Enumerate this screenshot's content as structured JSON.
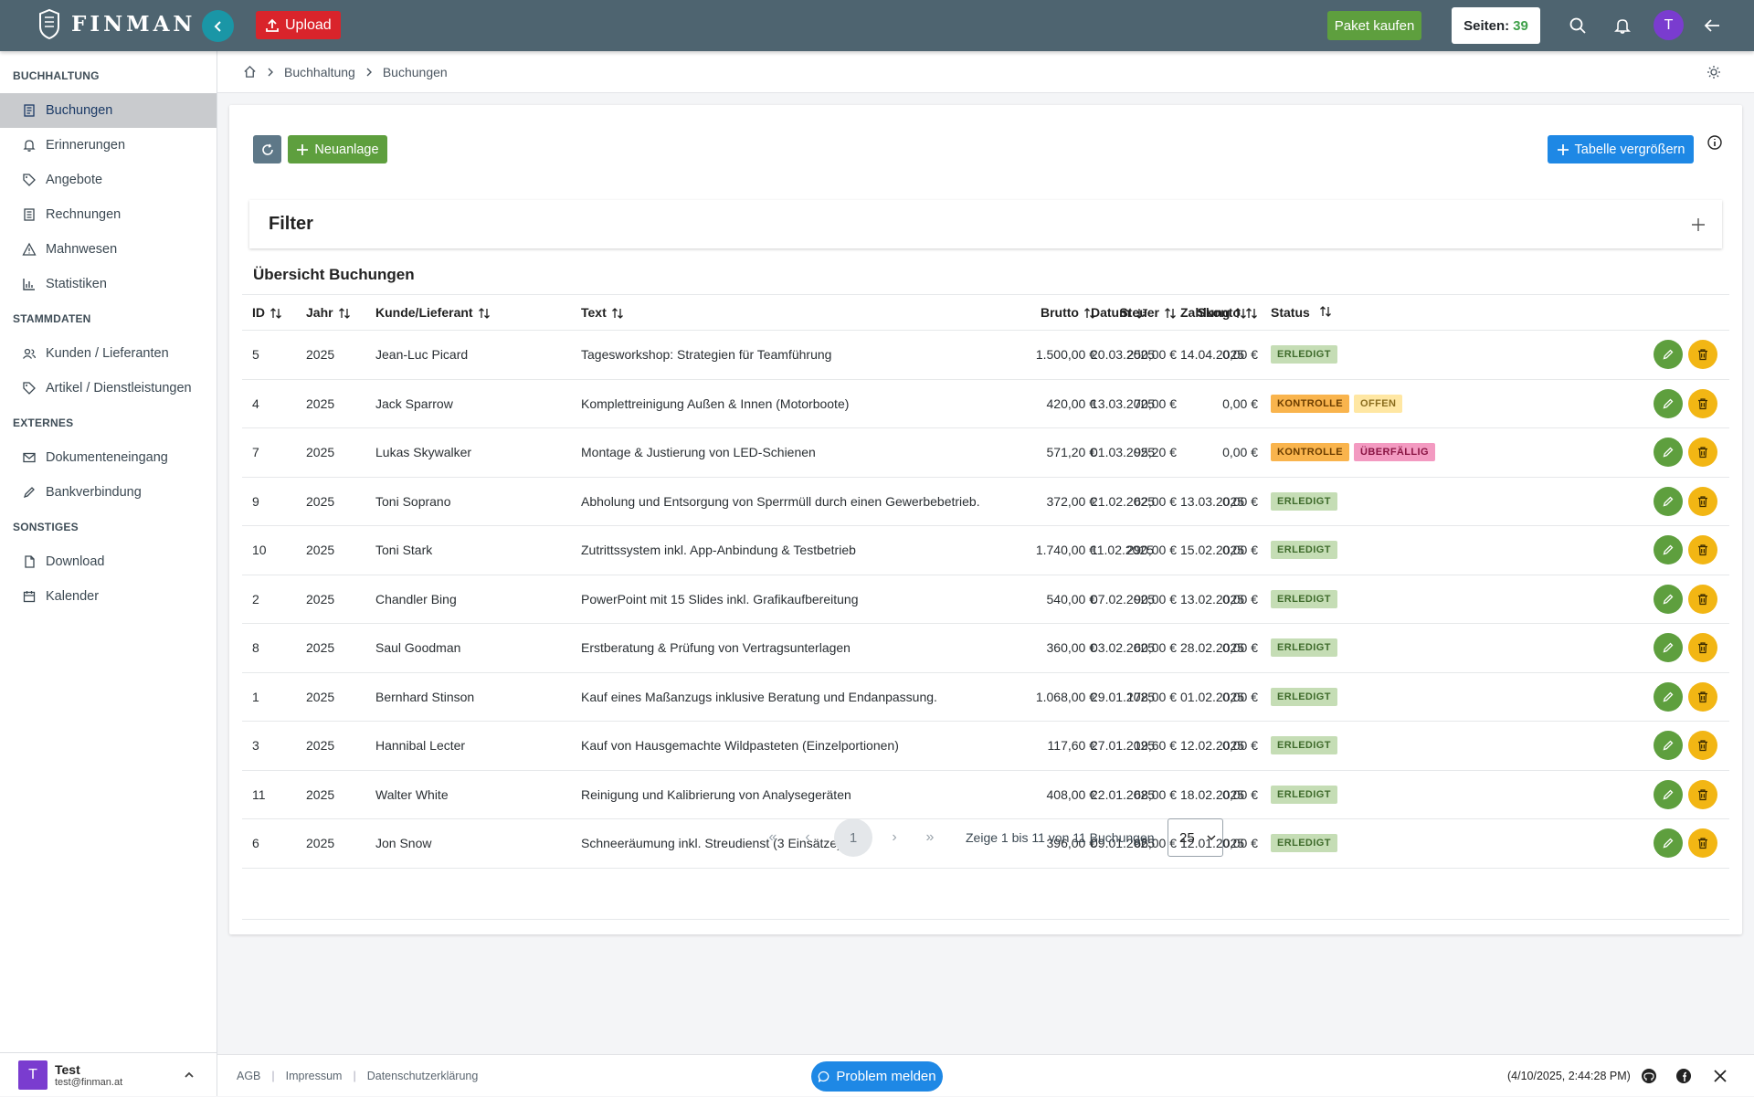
{
  "app": {
    "name": "FINMAN"
  },
  "topbar": {
    "upload_label": "Upload",
    "buy_label": "Paket kaufen",
    "pages_label": "Seiten:",
    "pages_value": "39",
    "avatar_letter": "T"
  },
  "sidebar": {
    "sections": [
      {
        "title": "BUCHHALTUNG",
        "items": [
          {
            "label": "Buchungen",
            "icon": "ledger-icon",
            "active": true
          },
          {
            "label": "Erinnerungen",
            "icon": "bell-icon"
          },
          {
            "label": "Angebote",
            "icon": "tag-icon"
          },
          {
            "label": "Rechnungen",
            "icon": "invoice-icon"
          },
          {
            "label": "Mahnwesen",
            "icon": "warning-icon"
          },
          {
            "label": "Statistiken",
            "icon": "chart-icon"
          }
        ]
      },
      {
        "title": "STAMMDATEN",
        "items": [
          {
            "label": "Kunden / Lieferanten",
            "icon": "users-icon"
          },
          {
            "label": "Artikel / Dienstleistungen",
            "icon": "tag-icon"
          }
        ]
      },
      {
        "title": "EXTERNES",
        "items": [
          {
            "label": "Dokumenteneingang",
            "icon": "mail-icon"
          },
          {
            "label": "Bankverbindung",
            "icon": "pen-icon"
          }
        ]
      },
      {
        "title": "SONSTIGES",
        "items": [
          {
            "label": "Download",
            "icon": "file-icon"
          },
          {
            "label": "Kalender",
            "icon": "calendar-icon"
          }
        ]
      }
    ],
    "user": {
      "initial": "T",
      "name": "Test",
      "email": "test@finman.at"
    }
  },
  "breadcrumb": {
    "items": [
      "Buchhaltung",
      "Buchungen"
    ]
  },
  "toolbar": {
    "new_label": "Neuanlage",
    "enlarge_label": "Tabelle vergrößern"
  },
  "filter": {
    "title": "Filter"
  },
  "overview": {
    "title": "Übersicht Buchungen"
  },
  "table": {
    "headers": {
      "id": "ID",
      "jahr": "Jahr",
      "kunde": "Kunde/Lieferant",
      "text": "Text",
      "brutto": "Brutto",
      "steuer": "Steuer",
      "skonto": "Skonto",
      "datum": "Datum",
      "zahlung": "Zahlung",
      "status": "Status"
    },
    "rows": [
      {
        "id": "5",
        "jahr": "2025",
        "kunde": "Jean-Luc Picard",
        "text": "Tagesworkshop: Strategien für Teamführung",
        "brutto": "1.500,00 €",
        "steuer": "250,00 €",
        "skonto": "0,00 €",
        "datum": "20.03.2025",
        "zahlung": "14.04.2025",
        "status": [
          {
            "label": "ERLEDIGT",
            "kind": "done"
          }
        ]
      },
      {
        "id": "4",
        "jahr": "2025",
        "kunde": "Jack Sparrow",
        "text": "Komplettreinigung Außen & Innen (Motorboote)",
        "brutto": "420,00 €",
        "steuer": "70,00 €",
        "skonto": "0,00 €",
        "datum": "13.03.2025",
        "zahlung": "",
        "status": [
          {
            "label": "KONTROLLE",
            "kind": "check"
          },
          {
            "label": "OFFEN",
            "kind": "open"
          }
        ]
      },
      {
        "id": "7",
        "jahr": "2025",
        "kunde": "Lukas Skywalker",
        "text": "Montage & Justierung von LED-Schienen",
        "brutto": "571,20 €",
        "steuer": "95,20 €",
        "skonto": "0,00 €",
        "datum": "01.03.2025",
        "zahlung": "",
        "status": [
          {
            "label": "KONTROLLE",
            "kind": "check"
          },
          {
            "label": "ÜBERFÄLLIG",
            "kind": "over"
          }
        ]
      },
      {
        "id": "9",
        "jahr": "2025",
        "kunde": "Toni Soprano",
        "text": "Abholung und Entsorgung von Sperrmüll durch einen Gewerbebetrieb.",
        "brutto": "372,00 €",
        "steuer": "62,00 €",
        "skonto": "0,00 €",
        "datum": "21.02.2025",
        "zahlung": "13.03.2025",
        "status": [
          {
            "label": "ERLEDIGT",
            "kind": "done"
          }
        ]
      },
      {
        "id": "10",
        "jahr": "2025",
        "kunde": "Toni Stark",
        "text": "Zutrittssystem inkl. App-Anbindung & Testbetrieb",
        "brutto": "1.740,00 €",
        "steuer": "290,00 €",
        "skonto": "0,00 €",
        "datum": "11.02.2025",
        "zahlung": "15.02.2025",
        "status": [
          {
            "label": "ERLEDIGT",
            "kind": "done"
          }
        ]
      },
      {
        "id": "2",
        "jahr": "2025",
        "kunde": "Chandler Bing",
        "text": "PowerPoint mit 15 Slides inkl. Grafikaufbereitung",
        "brutto": "540,00 €",
        "steuer": "90,00 €",
        "skonto": "0,00 €",
        "datum": "07.02.2025",
        "zahlung": "13.02.2025",
        "status": [
          {
            "label": "ERLEDIGT",
            "kind": "done"
          }
        ]
      },
      {
        "id": "8",
        "jahr": "2025",
        "kunde": "Saul Goodman",
        "text": "Erstberatung & Prüfung von Vertragsunterlagen",
        "brutto": "360,00 €",
        "steuer": "60,00 €",
        "skonto": "0,00 €",
        "datum": "03.02.2025",
        "zahlung": "28.02.2025",
        "status": [
          {
            "label": "ERLEDIGT",
            "kind": "done"
          }
        ]
      },
      {
        "id": "1",
        "jahr": "2025",
        "kunde": "Bernhard Stinson",
        "text": "Kauf eines Maßanzugs inklusive Beratung und Endanpassung.",
        "brutto": "1.068,00 €",
        "steuer": "178,00 €",
        "skonto": "0,00 €",
        "datum": "29.01.2025",
        "zahlung": "01.02.2025",
        "status": [
          {
            "label": "ERLEDIGT",
            "kind": "done"
          }
        ]
      },
      {
        "id": "3",
        "jahr": "2025",
        "kunde": "Hannibal Lecter",
        "text": "Kauf von Hausgemachte Wildpasteten (Einzelportionen)",
        "brutto": "117,60 €",
        "steuer": "19,60 €",
        "skonto": "0,00 €",
        "datum": "27.01.2025",
        "zahlung": "12.02.2025",
        "status": [
          {
            "label": "ERLEDIGT",
            "kind": "done"
          }
        ]
      },
      {
        "id": "11",
        "jahr": "2025",
        "kunde": "Walter White",
        "text": "Reinigung und Kalibrierung von Analysegeräten",
        "brutto": "408,00 €",
        "steuer": "68,00 €",
        "skonto": "0,00 €",
        "datum": "22.01.2025",
        "zahlung": "18.02.2025",
        "status": [
          {
            "label": "ERLEDIGT",
            "kind": "done"
          }
        ]
      },
      {
        "id": "6",
        "jahr": "2025",
        "kunde": "Jon Snow",
        "text": "Schneeräumung inkl. Streudienst (3 Einsätze)",
        "brutto": "396,00 €",
        "steuer": "66,00 €",
        "skonto": "0,00 €",
        "datum": "09.01.2025",
        "zahlung": "12.01.2025",
        "status": [
          {
            "label": "ERLEDIGT",
            "kind": "done"
          }
        ]
      }
    ]
  },
  "pagination": {
    "current_page": "1",
    "summary": "Zeige 1 bis 11 von 11 Buchungen",
    "page_size": "25"
  },
  "footer": {
    "links": [
      "AGB",
      "Impressum",
      "Datenschutzerklärung"
    ],
    "problem_label": "Problem melden",
    "timestamp": "(4/10/2025, 2:44:28 PM)"
  },
  "colors": {
    "topbar": "#4e6470",
    "accent_green": "#5e9f3e",
    "accent_blue": "#1e88e5",
    "accent_red": "#d9242b",
    "teal": "#1a96a6"
  }
}
